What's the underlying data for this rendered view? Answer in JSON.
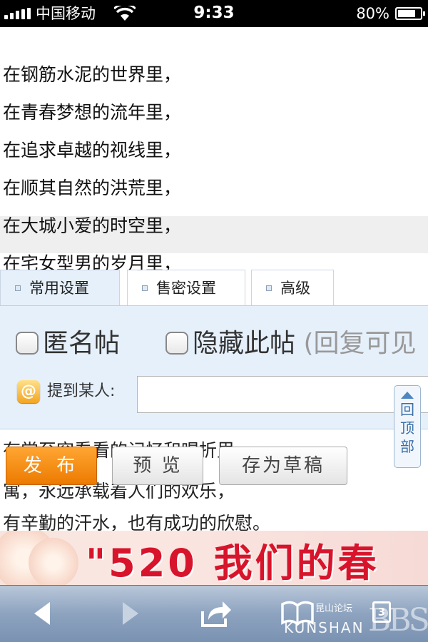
{
  "status_bar": {
    "carrier": "中国移动",
    "time": "9:33",
    "battery_percent": "80%",
    "battery_level": 0.8,
    "signal_bars": 5
  },
  "poem": {
    "lines": [
      "在钢筋水泥的世界里，",
      "在青春梦想的流年里，",
      "在追求卓越的视线里，",
      "在顺其自然的洪荒里，",
      "在大城小爱的时空里，",
      "在宅女型男的岁月里，"
    ]
  },
  "editor": {
    "tabs": [
      {
        "label": "常用设置"
      },
      {
        "label": "售密设置"
      },
      {
        "label": "高级"
      }
    ],
    "anonymous_label": "匿名帖",
    "hide_label": "隐藏此帖",
    "hide_note": "(回复可见",
    "mention_label": "提到某人:",
    "mention_value": ""
  },
  "back_to_top": {
    "chars": [
      "回",
      "顶",
      "部"
    ]
  },
  "tail_text": {
    "line1": "有常至突看看的记忆和喝折里",
    "line2": "寓，永远承载着人们的欢乐，",
    "line3": "有辛勤的汗水，也有成功的欣慰。"
  },
  "buttons": {
    "publish": "发 布",
    "preview": "预 览",
    "save_draft": "存为草稿"
  },
  "banner": {
    "text": "\"520 我们的春"
  },
  "toolbar": {
    "pages_count": "3"
  },
  "watermark": {
    "cn": "昆山论坛",
    "en": "KUNSHAN",
    "bbs": "BBS"
  },
  "colors": {
    "accent_orange": "#ec7a00",
    "panel_blue": "#e6f0fb",
    "link_blue": "#3a6fa8",
    "banner_red": "#d7142b"
  },
  "icons": {
    "back": "back-arrow-icon",
    "forward": "forward-arrow-icon",
    "share": "share-icon",
    "bookmarks": "open-book-icon",
    "pages": "pages-icon",
    "mention": "at-sign-icon"
  }
}
